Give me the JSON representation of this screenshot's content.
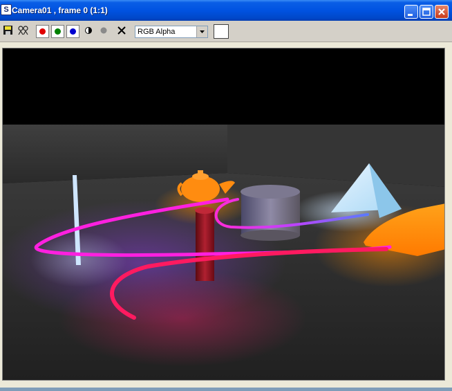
{
  "window": {
    "title": "Camera01 , frame 0 (1:1)",
    "app_icon_glyph": "S"
  },
  "toolbar": {
    "channel_select_value": "RGB Alpha",
    "color_channels": [
      {
        "name": "red",
        "color": "#e00000"
      },
      {
        "name": "green",
        "color": "#008000"
      },
      {
        "name": "blue",
        "color": "#0000d0"
      }
    ],
    "swatch_color": "#ffffff"
  },
  "icons": [
    "save-icon",
    "clone-icon",
    "monochrome-icon",
    "alpha-icon",
    "clear-icon",
    "chevron-down-icon",
    "minimize-icon",
    "maximize-icon",
    "close-icon"
  ]
}
